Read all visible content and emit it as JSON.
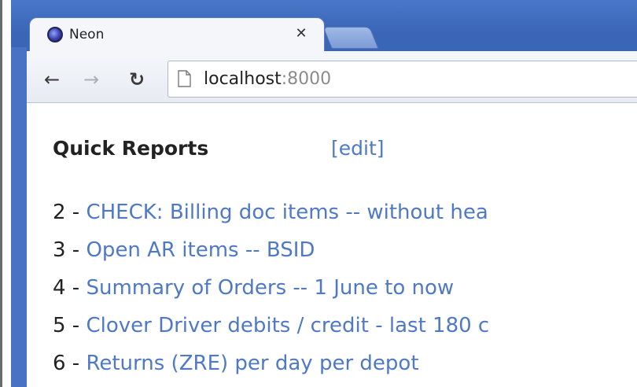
{
  "browser": {
    "tab": {
      "title": "Neon",
      "close_icon": "close-icon",
      "favicon": "neon-favicon-icon"
    },
    "toolbar": {
      "back_icon": "back-arrow-icon",
      "forward_icon": "forward-arrow-icon",
      "reload_icon": "reload-icon"
    },
    "address_bar": {
      "host": "localhost",
      "port": ":8000",
      "page_icon": "page-icon"
    }
  },
  "page": {
    "heading": "Quick Reports",
    "edit_label": "[edit]",
    "separator": " - ",
    "reports": [
      {
        "number": "2",
        "label": "CHECK: Billing doc items -- without hea"
      },
      {
        "number": "3",
        "label": "Open AR items -- BSID"
      },
      {
        "number": "4",
        "label": "Summary of Orders -- 1 June to now"
      },
      {
        "number": "5",
        "label": "Clover Driver debits / credit - last 180 c"
      },
      {
        "number": "6",
        "label": "Returns (ZRE) per day per depot"
      }
    ]
  },
  "colors": {
    "link": "#4f79c6",
    "chrome_blue": "#3b66b8",
    "text": "#222222"
  }
}
